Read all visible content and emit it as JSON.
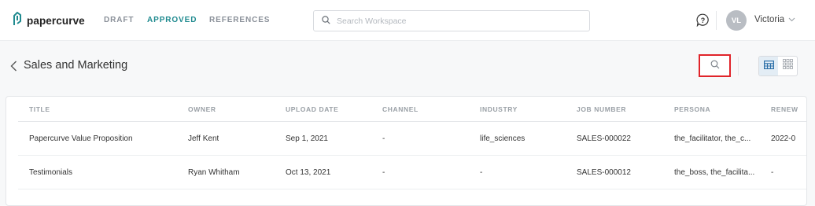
{
  "app": {
    "brand": "papercurve"
  },
  "nav": {
    "draft": "DRAFT",
    "approved": "APPROVED",
    "references": "REFERENCES"
  },
  "search": {
    "placeholder": "Search Workspace"
  },
  "user": {
    "initials": "VL",
    "name": "Victoria"
  },
  "page": {
    "title": "Sales and Marketing"
  },
  "table": {
    "columns": [
      "TITLE",
      "OWNER",
      "UPLOAD DATE",
      "CHANNEL",
      "INDUSTRY",
      "JOB NUMBER",
      "PERSONA",
      "RENEW"
    ],
    "rows": [
      {
        "title": "Papercurve Value Proposition",
        "owner": "Jeff Kent",
        "upload_date": "Sep 1, 2021",
        "channel": "-",
        "industry": "life_sciences",
        "job_number": "SALES-000022",
        "persona": "the_facilitator, the_c...",
        "renew": "2022-0"
      },
      {
        "title": "Testimonials",
        "owner": "Ryan Whitham",
        "upload_date": "Oct 13, 2021",
        "channel": "-",
        "industry": "-",
        "job_number": "SALES-000012",
        "persona": "the_boss, the_facilita...",
        "renew": "-"
      }
    ]
  },
  "colors": {
    "accent": "#1f8a8f",
    "highlight": "#e0242a",
    "view_active": "#e3edf5"
  },
  "icons": [
    "papercurve-logo-icon",
    "search-icon",
    "help-icon",
    "chevron-down-icon",
    "chevron-left-icon",
    "table-view-icon",
    "grid-view-icon"
  ]
}
